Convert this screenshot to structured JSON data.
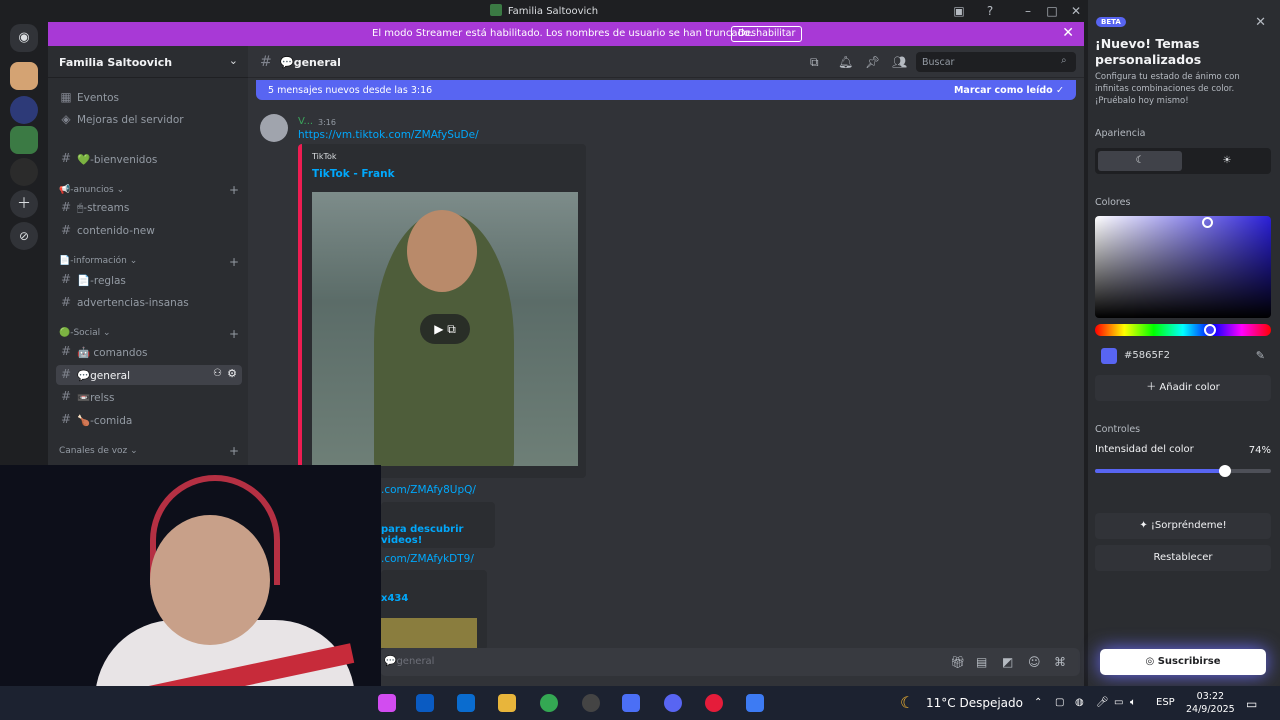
{
  "window": {
    "title": "Familia Saltoovich"
  },
  "banner": {
    "text": "El modo Streamer está habilitado. Los nombres de usuario se han truncado.",
    "button": "Deshabilitar"
  },
  "server": {
    "name": "Familia Saltoovich"
  },
  "sidebar": {
    "top_items": [
      {
        "label": "Eventos",
        "icon": "calendar-icon"
      },
      {
        "label": "Mejoras del servidor",
        "icon": "boost-icon"
      }
    ],
    "categories": {
      "anuncios": "📢-anuncios",
      "informacion": "📄-información",
      "social": "🟢-Social",
      "voz": "Canales de voz"
    },
    "channels": {
      "bienvenidos": "💚-bienvenidos",
      "streams": "🖱-streams",
      "contenido": "contenido-new",
      "reglas": "📄-reglas",
      "advertencias": "advertencias-insanas",
      "comandos": "🤖 comandos",
      "general": "💬general",
      "relss": "📼relss",
      "comida": "🍗-comida"
    }
  },
  "chat": {
    "channel": "💬general",
    "search_placeholder": "Buscar",
    "new_messages": "5 mensajes nuevos desde las 3:16",
    "mark_read": "Marcar como leído",
    "message": {
      "author": "V...",
      "time": "3:16",
      "link": "https://vm.tiktok.com/ZMAfySuDe/",
      "embed_provider": "TikTok",
      "embed_title": "TikTok - Frank"
    },
    "partial": {
      "link2": ".com/ZMAfy8UpQ/",
      "embed2_title": "para descubrir videos!",
      "link3": ".com/ZMAfykDT9/",
      "embed3_title": "x434"
    },
    "composer_placeholder": "💬general"
  },
  "panel": {
    "badge": "BETA",
    "title": "¡Nuevo! Temas personalizados",
    "description": "Configura tu estado de ánimo con infinitas combinaciones de color. ¡Pruébalo hoy mismo!",
    "appearance_label": "Apariencia",
    "colors_label": "Colores",
    "hex": "#5865F2",
    "add_color": "Añadir color",
    "controls_label": "Controles",
    "intensity_label": "Intensidad del color",
    "intensity_value": "74%",
    "intensity": 0.74,
    "surprise": "¡Sorpréndeme!",
    "reset": "Restablecer",
    "subscribe": "Suscribirse",
    "accent": "#5865F2"
  },
  "taskbar": {
    "weather": "11°C  Despejado",
    "lang": "ESP",
    "time": "03:22",
    "date": "24/9/2025"
  }
}
